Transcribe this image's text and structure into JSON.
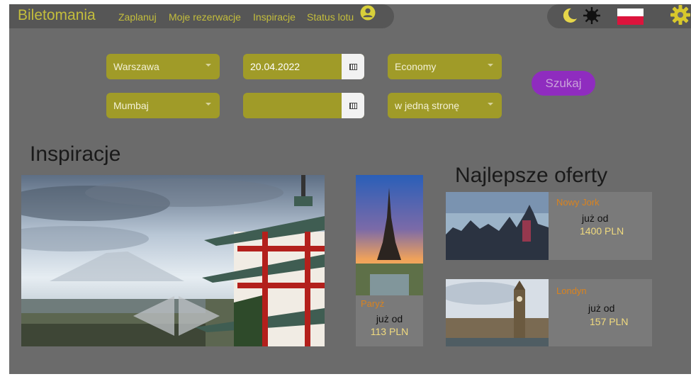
{
  "header": {
    "brand": "Biletomania",
    "nav": [
      "Zaplanuj",
      "Moje rezerwacje",
      "Inspiracje",
      "Status lotu"
    ]
  },
  "icons": {
    "user": "user-circle-icon",
    "theme_dark": "moon-icon",
    "theme_light": "sun-icon",
    "language": "poland-flag-icon",
    "settings": "gear-icon"
  },
  "search": {
    "from": "Warszawa",
    "to": "Mumbaj",
    "depart_date": "20.04.2022",
    "return_date": "",
    "class": "Economy",
    "trip_type": "w jedną stronę",
    "submit_label": "Szukaj"
  },
  "inspirations": {
    "title": "Inspiracje",
    "card": {
      "city": "Paryż",
      "from_label": "już od",
      "price": "113 PLN"
    }
  },
  "offers": {
    "title": "Najlepsze oferty",
    "items": [
      {
        "city": "Nowy Jork",
        "from_label": "już od",
        "price": "1400 PLN"
      },
      {
        "city": "Londyn",
        "from_label": "już od",
        "price": "157 PLN"
      }
    ]
  },
  "colors": {
    "background": "#6b6b6b",
    "accent": "#a09b28",
    "brand_text": "#c4be3c",
    "button": "#8f2cbf",
    "city_text": "#d9831f",
    "price_text": "#f0da7e"
  }
}
